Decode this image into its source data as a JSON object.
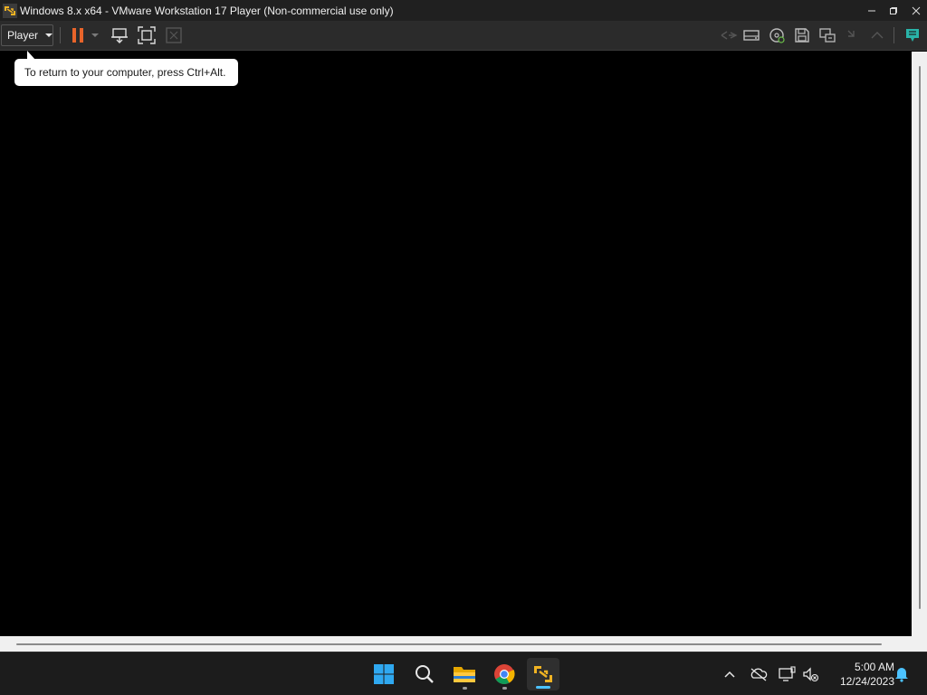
{
  "window": {
    "title": "Windows 8.x x64 - VMware Workstation 17 Player (Non-commercial use only)",
    "controls": [
      "minimize-icon",
      "restore-icon",
      "close-icon"
    ]
  },
  "toolbar": {
    "player_menu_label": "Player",
    "icons": [
      "pause-icon",
      "dropdown-arrow-icon",
      "send-ctrl-alt-del-icon",
      "fullscreen-icon",
      "unity-icon",
      "network-adapter-icon",
      "removable-device-icon",
      "cd-dvd-icon",
      "floppy-icon",
      "usb-devices-icon",
      "sound-card-icon",
      "message-log-icon"
    ],
    "accent_color": "#e8642a"
  },
  "tooltip": {
    "text": "To return to your computer, press Ctrl+Alt."
  },
  "taskbar": {
    "apps": [
      "windows-start-icon",
      "search-icon",
      "file-explorer-icon",
      "chrome-icon",
      "vmware-player-icon"
    ],
    "tray": [
      "show-hidden-icons-icon",
      "onedrive-icon",
      "display-icon",
      "network-volume-icon",
      "notification-bell-icon"
    ],
    "time": "5:00 AM",
    "date": "12/24/2023",
    "accent_color": "#4cc2ff"
  }
}
